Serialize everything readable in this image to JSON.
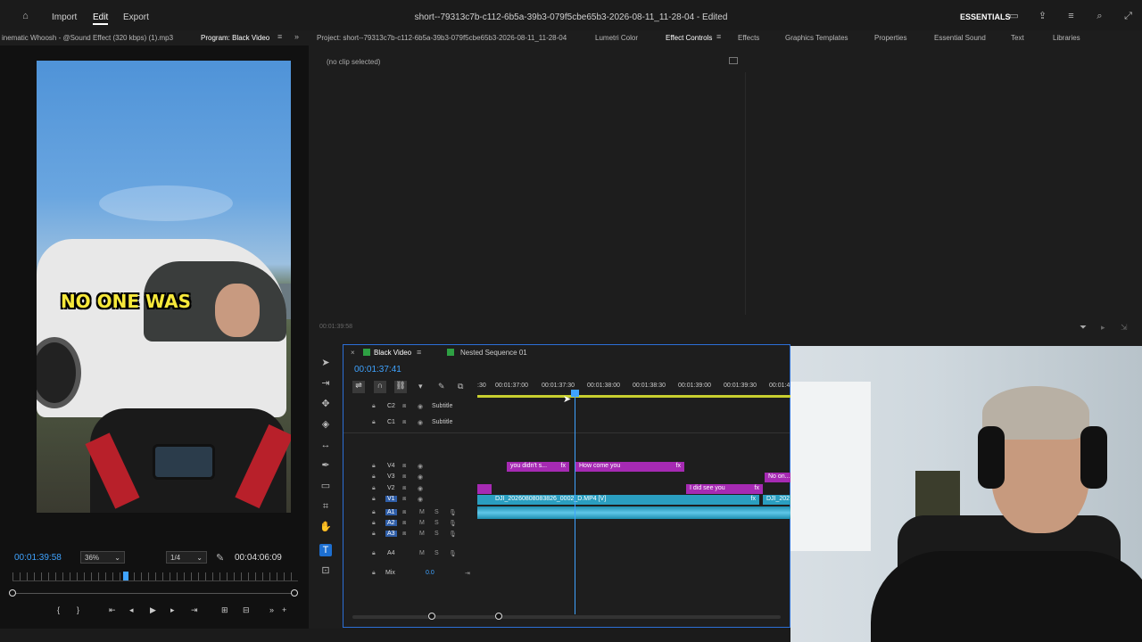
{
  "topbar": {
    "home_icon": "home-icon",
    "import": "Import",
    "edit": "Edit",
    "export": "Export",
    "title": "short--79313c7b-c112-6b5a-39b3-079f5cbe65b3-2026-08-11_11-28-04 - Edited",
    "essentials": "ESSENTIALS",
    "icons": [
      "workspace-icon",
      "share-icon",
      "menu-icon",
      "search-icon",
      "expand-icon"
    ]
  },
  "panels": {
    "source": "inematic Whoosh - @Sound Effect (320 kbps) (1).mp3",
    "program": "Program: Black Video",
    "project": "Project: short--79313c7b-c112-6b5a-39b3-079f5cbe65b3-2026-08-11_11-28-04",
    "lumetri": "Lumetri Color",
    "effect_controls": "Effect Controls",
    "effects": "Effects",
    "graphics_templates": "Graphics Templates",
    "properties": "Properties",
    "essential_sound": "Essential Sound",
    "text": "Text",
    "libraries": "Libraries"
  },
  "program_monitor": {
    "caption": "NO ONE WAS",
    "current_timecode": "00:01:39:58",
    "zoom": "36%",
    "resolution": "1/4",
    "duration": "00:04:06:09"
  },
  "effect_controls": {
    "no_clip": "(no clip selected)",
    "timecode": "00:01:39:58"
  },
  "timeline": {
    "tab_active": "Black Video",
    "tab_other": "Nested Sequence 01",
    "timecode": "00:01:37:41",
    "ruler": [
      ":30",
      "00:01:37:00",
      "00:01:37:30",
      "00:01:38:00",
      "00:01:38:30",
      "00:01:39:00",
      "00:01:39:30",
      "00:01:4"
    ],
    "tracks": {
      "c2": "C2",
      "c1": "C1",
      "subtitle": "Subtitle",
      "v4": "V4",
      "v3": "V3",
      "v2": "V2",
      "v1": "V1",
      "a1": "A1",
      "a2": "A2",
      "a3": "A3",
      "a4": "A4",
      "mix": "Mix",
      "mix_value": "0.0",
      "m": "M",
      "s": "S"
    },
    "clips": {
      "you_didnt": "you didn't s...",
      "how_come": "How come you",
      "no_on": "No on...",
      "i_did_see": "I did see you",
      "v1_clip": "DJI_20260808083826_0002_D.MP4 [V]",
      "v1_clip2": "DJI_202",
      "fx": "fx"
    }
  }
}
